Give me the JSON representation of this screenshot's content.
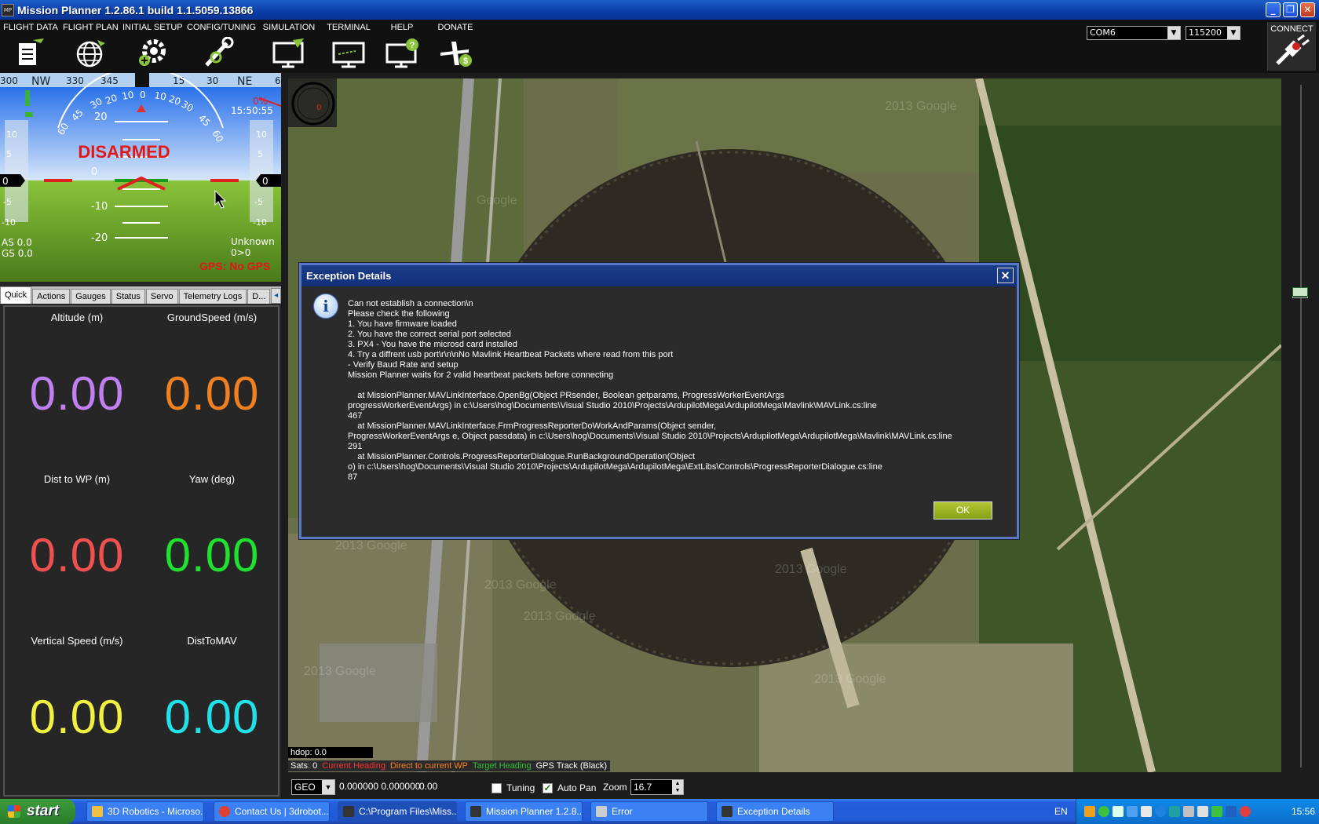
{
  "window": {
    "title": "Mission Planner 1.2.86.1 build 1.1.5059.13866",
    "icon_label": "MP"
  },
  "menu": {
    "items": [
      {
        "label": "FLIGHT DATA",
        "icon": "flight-data-icon"
      },
      {
        "label": "FLIGHT PLAN",
        "icon": "globe-icon"
      },
      {
        "label": "INITIAL SETUP",
        "icon": "gear-icon"
      },
      {
        "label": "CONFIG/TUNING",
        "icon": "wrench-icon"
      },
      {
        "label": "SIMULATION",
        "icon": "simulation-icon"
      },
      {
        "label": "TERMINAL",
        "icon": "terminal-icon"
      },
      {
        "label": "HELP",
        "icon": "help-icon"
      },
      {
        "label": "DONATE",
        "icon": "donate-icon"
      }
    ],
    "port": "COM6",
    "baud": "115200",
    "connect_label": "CONNECT"
  },
  "hud": {
    "compass_labels": [
      "300",
      "NW",
      "330",
      "345",
      "0",
      "15",
      "30",
      "NE",
      "6"
    ],
    "status": "DISARMED",
    "time": "15:50:55",
    "battery": "0%",
    "pitch_labels": [
      "20",
      "10",
      "0",
      "-10",
      "-20"
    ],
    "left_scale": [
      "10",
      "5",
      "0",
      "-5",
      "-10"
    ],
    "right_scale": [
      "10",
      "5",
      "0",
      "-5",
      "-10"
    ],
    "roll_labels": [
      "60",
      "45",
      "30",
      "20",
      "10",
      "0",
      "10",
      "20",
      "30",
      "45",
      "60"
    ],
    "airspeed": "AS 0.0",
    "groundspeed": "GS 0.0",
    "mode": "Unknown",
    "wp_info": "0>0",
    "gps": "GPS: No GPS"
  },
  "tabs": [
    "Quick",
    "Actions",
    "Gauges",
    "Status",
    "Servo",
    "Telemetry Logs",
    "D..."
  ],
  "quick": [
    {
      "label": "Altitude (m)",
      "value": "0.00",
      "color": "#c080f0"
    },
    {
      "label": "GroundSpeed (m/s)",
      "value": "0.00",
      "color": "#f08020"
    },
    {
      "label": "Dist to WP (m)",
      "value": "0.00",
      "color": "#f05050"
    },
    {
      "label": "Yaw (deg)",
      "value": "0.00",
      "color": "#20e030"
    },
    {
      "label": "Vertical Speed (m/s)",
      "value": "0.00",
      "color": "#f0f040"
    },
    {
      "label": "DistToMAV",
      "value": "0.00",
      "color": "#20e0e8"
    }
  ],
  "map": {
    "heading_value": "0",
    "watermarks": [
      "Google",
      "2013 Google",
      "2013 Google",
      "2013 Google",
      "2013 Google",
      "2013 Google",
      "2013 Google",
      "2013 Google"
    ],
    "hdop": "hdop: 0.0",
    "sats": "Sats: 0",
    "legend": [
      {
        "label": "Current Heading",
        "color": "#ff3030"
      },
      {
        "label": "Direct to current WP",
        "color": "#ff8020"
      },
      {
        "label": "Target Heading",
        "color": "#30c030"
      },
      {
        "label": "GPS Track (Black)",
        "color": "#ffffff"
      }
    ]
  },
  "bottom": {
    "coord_system": "GEO",
    "coords": "0.000000 0.000000",
    "alt": "0.00",
    "tuning_label": "Tuning",
    "autopan_label": "Auto Pan",
    "zoom_label": "Zoom",
    "zoom_value": "16.7"
  },
  "dialog": {
    "title": "Exception Details",
    "message": "Can not establish a connection\\n\nPlease check the following\n1. You have firmware loaded\n2. You have the correct serial port selected\n3. PX4 - You have the microsd card installed\n4. Try a diffrent usb port\\r\\n\\nNo Mavlink Heartbeat Packets where read from this port\n- Verify Baud Rate and setup\nMission Planner waits for 2 valid heartbeat packets before connecting\n\n    at MissionPlanner.MAVLinkInterface.OpenBg(Object PRsender, Boolean getparams, ProgressWorkerEventArgs\nprogressWorkerEventArgs) in c:\\Users\\hog\\Documents\\Visual Studio 2010\\Projects\\ArdupilotMega\\ArdupilotMega\\Mavlink\\MAVLink.cs:line\n467\n    at MissionPlanner.MAVLinkInterface.FrmProgressReporterDoWorkAndParams(Object sender,\nProgressWorkerEventArgs e, Object passdata) in c:\\Users\\hog\\Documents\\Visual Studio 2010\\Projects\\ArdupilotMega\\ArdupilotMega\\Mavlink\\MAVLink.cs:line\n291\n    at MissionPlanner.Controls.ProgressReporterDialogue.RunBackgroundOperation(Object\no) in c:\\Users\\hog\\Documents\\Visual Studio 2010\\Projects\\ArdupilotMega\\ArdupilotMega\\ExtLibs\\Controls\\ProgressReporterDialogue.cs:line\n87",
    "ok_label": "OK"
  },
  "taskbar": {
    "start_label": "start",
    "tasks": [
      {
        "label": "3D Robotics - Microso...",
        "color": "#f0c040"
      },
      {
        "label": "Contact Us | 3drobot...",
        "color": "#e04030"
      },
      {
        "label": "C:\\Program Files\\Miss...",
        "color": "#333333"
      },
      {
        "label": "Mission Planner 1.2.8...",
        "color": "#333333"
      },
      {
        "label": "Error",
        "color": "#cccccc"
      },
      {
        "label": "Exception Details",
        "color": "#333333"
      }
    ],
    "lang": "EN",
    "clock": "15:56"
  }
}
